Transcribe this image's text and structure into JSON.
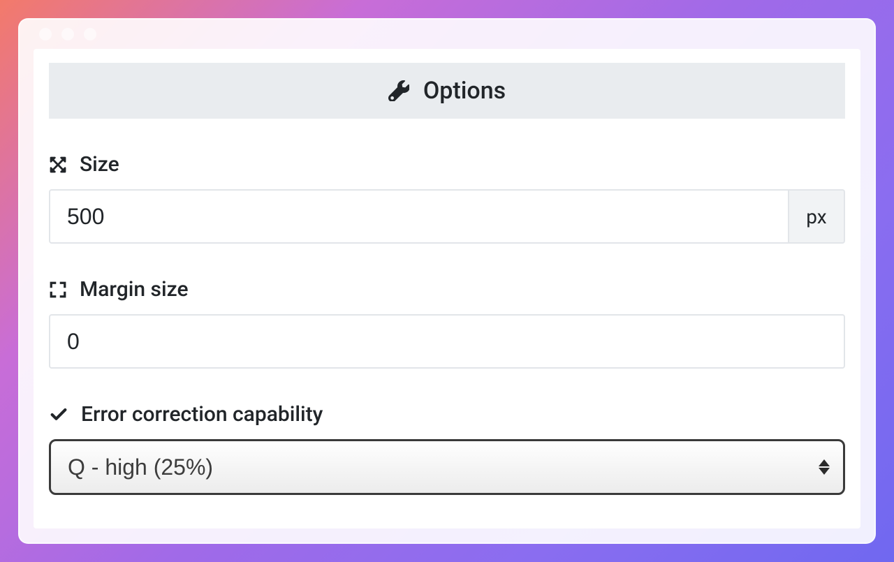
{
  "header": {
    "title": "Options"
  },
  "size": {
    "label": "Size",
    "value": "500",
    "unit": "px"
  },
  "margin": {
    "label": "Margin size",
    "value": "0"
  },
  "error_correction": {
    "label": "Error correction capability",
    "selected": "Q - high (25%)"
  }
}
